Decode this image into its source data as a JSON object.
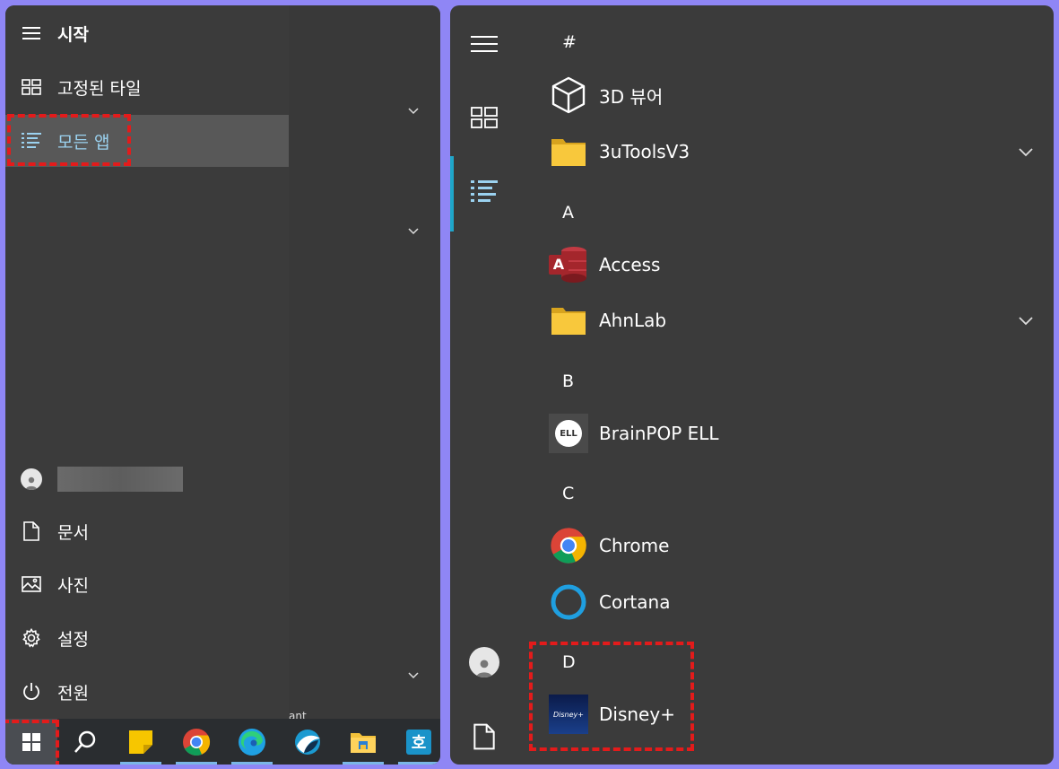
{
  "left_panel": {
    "header_title": "시작",
    "nav_items": [
      {
        "label": "고정된 타일"
      },
      {
        "label": "모든 앱"
      }
    ],
    "user_items": [
      {
        "label": "문서"
      },
      {
        "label": "사진"
      },
      {
        "label": "설정"
      },
      {
        "label": "전원"
      }
    ],
    "ghost_text": "ant",
    "taskbar": {
      "items": [
        "start-icon",
        "search-icon",
        "sticky-notes-icon",
        "chrome-icon",
        "edge-icon",
        "app-icon",
        "file-explorer-icon",
        "hangul-icon"
      ],
      "hangul_label": "호"
    }
  },
  "right_panel": {
    "sections": [
      {
        "letter": "#",
        "apps": [
          {
            "name": "3D 뷰어",
            "icon": "cube-icon"
          },
          {
            "name": "3uToolsV3",
            "icon": "folder-icon",
            "expandable": true
          }
        ]
      },
      {
        "letter": "A",
        "apps": [
          {
            "name": "Access",
            "icon": "access-icon"
          },
          {
            "name": "AhnLab",
            "icon": "folder-icon",
            "expandable": true
          }
        ]
      },
      {
        "letter": "B",
        "apps": [
          {
            "name": "BrainPOP ELL",
            "icon": "brainpop-icon"
          }
        ]
      },
      {
        "letter": "C",
        "apps": [
          {
            "name": "Chrome",
            "icon": "chrome-icon"
          },
          {
            "name": "Cortana",
            "icon": "cortana-icon"
          }
        ]
      },
      {
        "letter": "D",
        "apps": [
          {
            "name": "Disney+",
            "icon": "disney-icon"
          }
        ]
      }
    ],
    "access_letter": "A",
    "brainpop_letters": "ELL",
    "disney_logo": "Disney+"
  },
  "colors": {
    "highlight": "#e31b1b",
    "accent": "#1fa6c9",
    "background": "#8f86f5"
  }
}
